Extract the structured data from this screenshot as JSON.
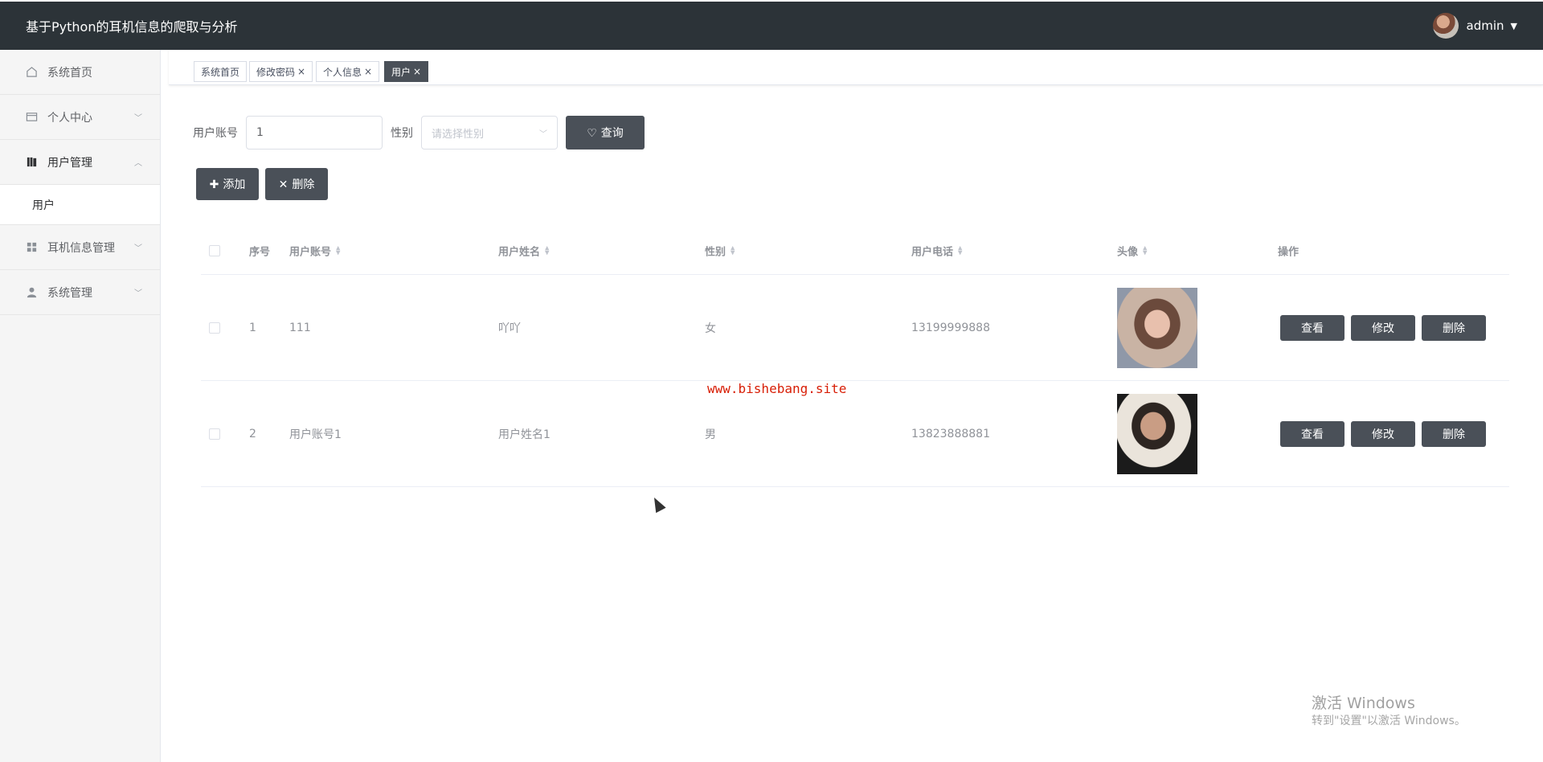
{
  "header": {
    "app_title": "基于Python的耳机信息的爬取与分析",
    "username": "admin",
    "caret": "▼"
  },
  "sidebar": {
    "items": [
      {
        "label": "系统首页",
        "icon": "home-icon"
      },
      {
        "label": "个人中心",
        "icon": "wallet-icon"
      },
      {
        "label": "用户管理",
        "icon": "book-icon"
      },
      {
        "label": "耳机信息管理",
        "icon": "grid-icon"
      },
      {
        "label": "系统管理",
        "icon": "user-icon"
      }
    ],
    "sub_items": [
      {
        "label": "用户"
      }
    ]
  },
  "tags": [
    {
      "label": "系统首页",
      "close": ""
    },
    {
      "label": "修改密码",
      "close": "×"
    },
    {
      "label": "个人信息",
      "close": "×"
    },
    {
      "label": "用户",
      "close": "×"
    }
  ],
  "search": {
    "account_label": "用户账号",
    "account_value": "1",
    "gender_label": "性别",
    "gender_placeholder": "请选择性别",
    "query_label": "查询"
  },
  "toolbar": {
    "add_label": "添加",
    "delete_label": "删除"
  },
  "table": {
    "columns": [
      "序号",
      "用户账号",
      "用户姓名",
      "性别",
      "用户电话",
      "头像",
      "操作"
    ],
    "rows": [
      {
        "index": "1",
        "account": "111",
        "name": "吖吖",
        "gender": "女",
        "phone": "13199999888",
        "avatar": "female-avatar"
      },
      {
        "index": "2",
        "account": "用户账号1",
        "name": "用户姓名1",
        "gender": "男",
        "phone": "13823888881",
        "avatar": "male-avatar"
      }
    ],
    "actions": {
      "view": "查看",
      "edit": "修改",
      "delete": "删除"
    }
  },
  "watermark": "www.bishebang.site",
  "windows_activation": {
    "line1": "激活 Windows",
    "line2": "转到\"设置\"以激活 Windows。"
  },
  "colors": {
    "topbar": "#2c3338",
    "accent_button": "#4a5058",
    "watermark": "#d81e06"
  }
}
